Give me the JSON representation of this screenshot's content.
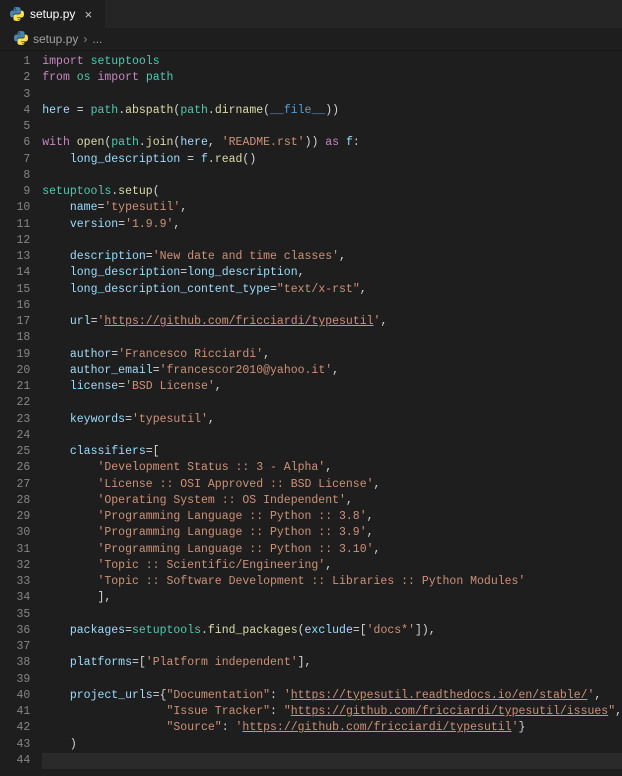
{
  "tab": {
    "icon": "python-icon",
    "label": "setup.py"
  },
  "breadcrumb": {
    "icon": "python-icon",
    "file": "setup.py",
    "more": "..."
  },
  "lines": 44,
  "code": {
    "l1": [
      [
        "kw",
        "import"
      ],
      [
        "pn",
        " "
      ],
      [
        "mod",
        "setuptools"
      ]
    ],
    "l2": [
      [
        "kw",
        "from"
      ],
      [
        "pn",
        " "
      ],
      [
        "mod",
        "os"
      ],
      [
        "pn",
        " "
      ],
      [
        "kw",
        "import"
      ],
      [
        "pn",
        " "
      ],
      [
        "mod",
        "path"
      ]
    ],
    "l3": [],
    "l4": [
      [
        "var",
        "here"
      ],
      [
        "pn",
        " = "
      ],
      [
        "mod",
        "path"
      ],
      [
        "pn",
        "."
      ],
      [
        "fn",
        "abspath"
      ],
      [
        "pn",
        "("
      ],
      [
        "mod",
        "path"
      ],
      [
        "pn",
        "."
      ],
      [
        "fn",
        "dirname"
      ],
      [
        "pn",
        "("
      ],
      [
        "const",
        "__file__"
      ],
      [
        "pn",
        "))"
      ]
    ],
    "l5": [],
    "l6": [
      [
        "kw",
        "with"
      ],
      [
        "pn",
        " "
      ],
      [
        "fn",
        "open"
      ],
      [
        "pn",
        "("
      ],
      [
        "mod",
        "path"
      ],
      [
        "pn",
        "."
      ],
      [
        "fn",
        "join"
      ],
      [
        "pn",
        "("
      ],
      [
        "var",
        "here"
      ],
      [
        "pn",
        ", "
      ],
      [
        "str",
        "'README.rst'"
      ],
      [
        "pn",
        ")) "
      ],
      [
        "kw",
        "as"
      ],
      [
        "pn",
        " "
      ],
      [
        "var",
        "f"
      ],
      [
        "pn",
        ":"
      ]
    ],
    "l7": [
      [
        "pn",
        "    "
      ],
      [
        "var",
        "long_description"
      ],
      [
        "pn",
        " = "
      ],
      [
        "var",
        "f"
      ],
      [
        "pn",
        "."
      ],
      [
        "fn",
        "read"
      ],
      [
        "pn",
        "()"
      ]
    ],
    "l8": [],
    "l9": [
      [
        "mod",
        "setuptools"
      ],
      [
        "pn",
        "."
      ],
      [
        "fn",
        "setup"
      ],
      [
        "pn",
        "("
      ]
    ],
    "l10": [
      [
        "pn",
        "    "
      ],
      [
        "var",
        "name"
      ],
      [
        "pn",
        "="
      ],
      [
        "str",
        "'typesutil'"
      ],
      [
        "pn",
        ","
      ]
    ],
    "l11": [
      [
        "pn",
        "    "
      ],
      [
        "var",
        "version"
      ],
      [
        "pn",
        "="
      ],
      [
        "str",
        "'1.9.9'"
      ],
      [
        "pn",
        ","
      ]
    ],
    "l12": [],
    "l13": [
      [
        "pn",
        "    "
      ],
      [
        "var",
        "description"
      ],
      [
        "pn",
        "="
      ],
      [
        "str",
        "'New date and time classes'"
      ],
      [
        "pn",
        ","
      ]
    ],
    "l14": [
      [
        "pn",
        "    "
      ],
      [
        "var",
        "long_description"
      ],
      [
        "pn",
        "="
      ],
      [
        "var",
        "long_description"
      ],
      [
        "pn",
        ","
      ]
    ],
    "l15": [
      [
        "pn",
        "    "
      ],
      [
        "var",
        "long_description_content_type"
      ],
      [
        "pn",
        "="
      ],
      [
        "str",
        "\"text/x-rst\""
      ],
      [
        "pn",
        ","
      ]
    ],
    "l16": [],
    "l17": [
      [
        "pn",
        "    "
      ],
      [
        "var",
        "url"
      ],
      [
        "pn",
        "="
      ],
      [
        "str",
        "'"
      ],
      [
        "str link",
        "https://github.com/fricciardi/typesutil"
      ],
      [
        "str",
        "'"
      ],
      [
        "pn",
        ","
      ]
    ],
    "l18": [],
    "l19": [
      [
        "pn",
        "    "
      ],
      [
        "var",
        "author"
      ],
      [
        "pn",
        "="
      ],
      [
        "str",
        "'Francesco Ricciardi'"
      ],
      [
        "pn",
        ","
      ]
    ],
    "l20": [
      [
        "pn",
        "    "
      ],
      [
        "var",
        "author_email"
      ],
      [
        "pn",
        "="
      ],
      [
        "str",
        "'francescor2010@yahoo.it'"
      ],
      [
        "pn",
        ","
      ]
    ],
    "l21": [
      [
        "pn",
        "    "
      ],
      [
        "var",
        "license"
      ],
      [
        "pn",
        "="
      ],
      [
        "str",
        "'BSD License'"
      ],
      [
        "pn",
        ","
      ]
    ],
    "l22": [],
    "l23": [
      [
        "pn",
        "    "
      ],
      [
        "var",
        "keywords"
      ],
      [
        "pn",
        "="
      ],
      [
        "str",
        "'typesutil'"
      ],
      [
        "pn",
        ","
      ]
    ],
    "l24": [],
    "l25": [
      [
        "pn",
        "    "
      ],
      [
        "var",
        "classifiers"
      ],
      [
        "pn",
        "=["
      ]
    ],
    "l26": [
      [
        "pn",
        "        "
      ],
      [
        "str",
        "'Development Status :: 3 - Alpha'"
      ],
      [
        "pn",
        ","
      ]
    ],
    "l27": [
      [
        "pn",
        "        "
      ],
      [
        "str",
        "'License :: OSI Approved :: BSD License'"
      ],
      [
        "pn",
        ","
      ]
    ],
    "l28": [
      [
        "pn",
        "        "
      ],
      [
        "str",
        "'Operating System :: OS Independent'"
      ],
      [
        "pn",
        ","
      ]
    ],
    "l29": [
      [
        "pn",
        "        "
      ],
      [
        "str",
        "'Programming Language :: Python :: 3.8'"
      ],
      [
        "pn",
        ","
      ]
    ],
    "l30": [
      [
        "pn",
        "        "
      ],
      [
        "str",
        "'Programming Language :: Python :: 3.9'"
      ],
      [
        "pn",
        ","
      ]
    ],
    "l31": [
      [
        "pn",
        "        "
      ],
      [
        "str",
        "'Programming Language :: Python :: 3.10'"
      ],
      [
        "pn",
        ","
      ]
    ],
    "l32": [
      [
        "pn",
        "        "
      ],
      [
        "str",
        "'Topic :: Scientific/Engineering'"
      ],
      [
        "pn",
        ","
      ]
    ],
    "l33": [
      [
        "pn",
        "        "
      ],
      [
        "str",
        "'Topic :: Software Development :: Libraries :: Python Modules'"
      ]
    ],
    "l34": [
      [
        "pn",
        "        ],"
      ]
    ],
    "l35": [],
    "l36": [
      [
        "pn",
        "    "
      ],
      [
        "var",
        "packages"
      ],
      [
        "pn",
        "="
      ],
      [
        "mod",
        "setuptools"
      ],
      [
        "pn",
        "."
      ],
      [
        "fn",
        "find_packages"
      ],
      [
        "pn",
        "("
      ],
      [
        "var",
        "exclude"
      ],
      [
        "pn",
        "=["
      ],
      [
        "str",
        "'docs*'"
      ],
      [
        "pn",
        "]),"
      ]
    ],
    "l37": [],
    "l38": [
      [
        "pn",
        "    "
      ],
      [
        "var",
        "platforms"
      ],
      [
        "pn",
        "=["
      ],
      [
        "str",
        "'Platform independent'"
      ],
      [
        "pn",
        "],"
      ]
    ],
    "l39": [],
    "l40": [
      [
        "pn",
        "    "
      ],
      [
        "var",
        "project_urls"
      ],
      [
        "pn",
        "={"
      ],
      [
        "str",
        "\"Documentation\""
      ],
      [
        "pn",
        ": "
      ],
      [
        "str",
        "'"
      ],
      [
        "str link",
        "https://typesutil.readthedocs.io/en/stable/"
      ],
      [
        "str",
        "'"
      ],
      [
        "pn",
        ","
      ]
    ],
    "l41": [
      [
        "pn",
        "                  "
      ],
      [
        "str",
        "\"Issue Tracker\""
      ],
      [
        "pn",
        ": "
      ],
      [
        "str",
        "\""
      ],
      [
        "str link",
        "https://github.com/fricciardi/typesutil/issues"
      ],
      [
        "str",
        "\""
      ],
      [
        "pn",
        ","
      ]
    ],
    "l42": [
      [
        "pn",
        "                  "
      ],
      [
        "str",
        "\"Source\""
      ],
      [
        "pn",
        ": "
      ],
      [
        "str",
        "'"
      ],
      [
        "str link",
        "https://github.com/fricciardi/typesutil"
      ],
      [
        "str",
        "'"
      ],
      [
        "pn",
        "}"
      ]
    ],
    "l43": [
      [
        "pn",
        "    )"
      ]
    ],
    "l44": []
  }
}
